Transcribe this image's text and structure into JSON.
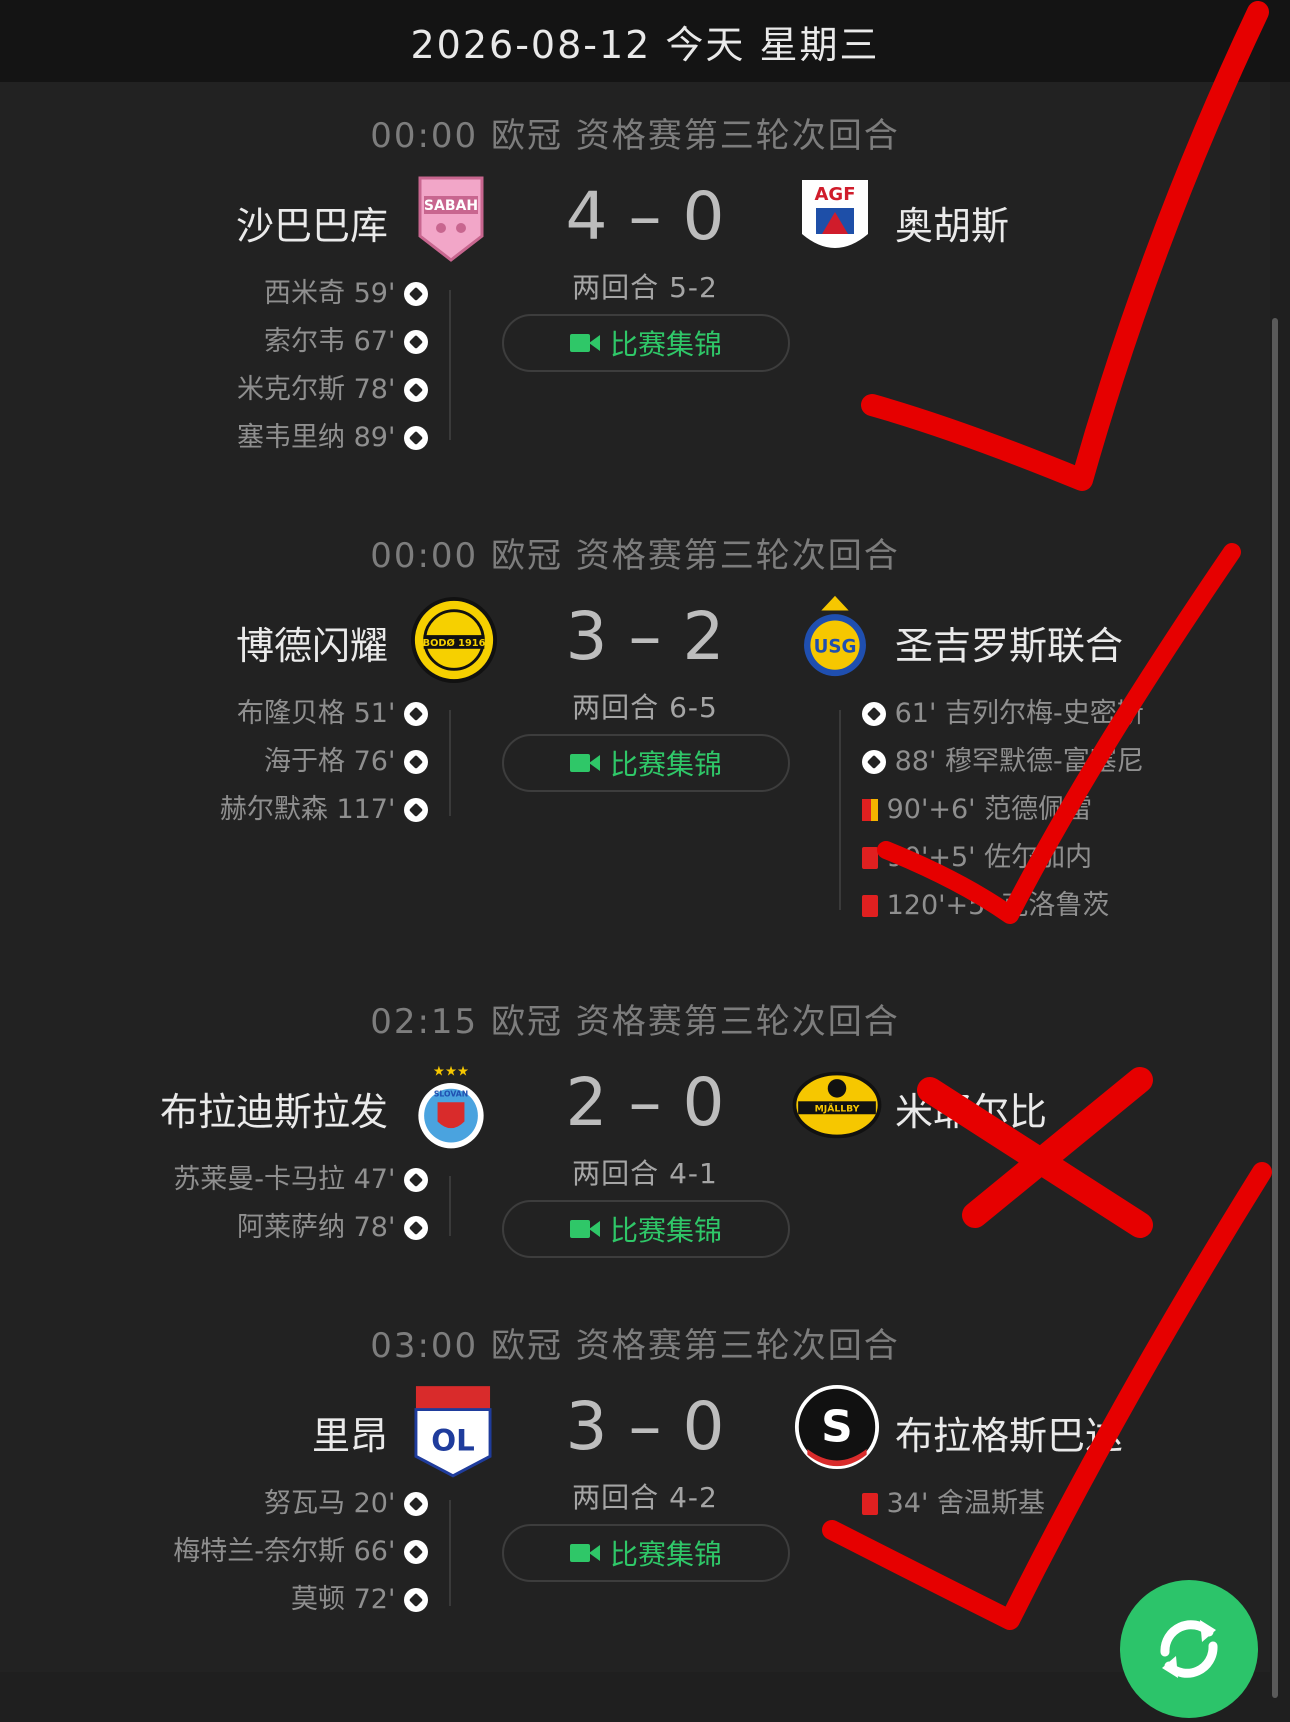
{
  "header": {
    "date_text": "2026-08-12 今天 星期三"
  },
  "highlight_label": "比赛集锦",
  "matches": [
    {
      "meta": "00:00 欧冠 资格赛第三轮次回合",
      "home": "沙巴巴库",
      "away": "奥胡斯",
      "score": "4 – 0",
      "aggregate": "两回合 5-2",
      "home_events": [
        "西米奇 59'",
        "索尔韦 67'",
        "米克尔斯 78'",
        "塞韦里纳 89'"
      ],
      "away_events": []
    },
    {
      "meta": "00:00 欧冠 资格赛第三轮次回合",
      "home": "博德闪耀",
      "away": "圣吉罗斯联合",
      "score": "3 – 2",
      "aggregate": "两回合 6-5",
      "home_events": [
        "布隆贝格 51'",
        "海于格 76'",
        "赫尔默森 117'"
      ],
      "away_events": [
        "61' 吉列尔梅-史密斯",
        "88' 穆罕默德-富塞尼",
        "90'+6' 范德佩雷",
        "90'+5' 佐尔加内",
        "120'+5' 克洛鲁茨"
      ]
    },
    {
      "meta": "02:15 欧冠 资格赛第三轮次回合",
      "home": "布拉迪斯拉发",
      "away": "米耶尔比",
      "score": "2 – 0",
      "aggregate": "两回合 4-1",
      "home_events": [
        "苏莱曼-卡马拉 47'",
        "阿莱萨纳 78'"
      ],
      "away_events": []
    },
    {
      "meta": "03:00 欧冠 资格赛第三轮次回合",
      "home": "里昂",
      "away": "布拉格斯巴达",
      "score": "3 – 0",
      "aggregate": "两回合 4-2",
      "home_events": [
        "努瓦马 20'",
        "梅特兰-奈尔斯 66'",
        "莫顿 72'"
      ],
      "away_events": [
        "34' 舍温斯基"
      ]
    }
  ],
  "logos": {
    "sabah": "SABAH",
    "agf": "AGF",
    "bodo": "BODØ 1916",
    "usg": "USG",
    "slovan": "SLOVAN",
    "mjallby": "MJÄLLBY",
    "lyon": "OL",
    "sparta": "S"
  },
  "colors": {
    "accent_green": "#2fc768",
    "red_card": "#e02020",
    "yellow_card": "#f4b400",
    "markup_red": "#e60000"
  }
}
